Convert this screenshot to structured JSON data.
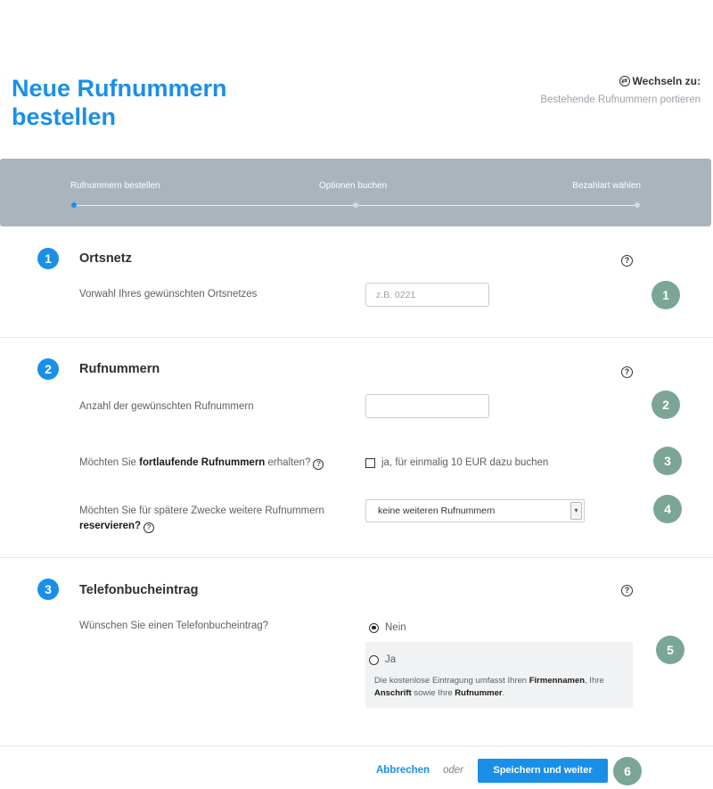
{
  "page": {
    "title": "Neue Rufnummern bestellen"
  },
  "switch": {
    "heading": "Wechseln zu:",
    "link": "Bestehende Rufnummern portieren"
  },
  "stepper": {
    "steps": [
      {
        "label": "Rufnummern bestellen",
        "active": true
      },
      {
        "label": "Optionen buchen",
        "active": false
      },
      {
        "label": "Bezahlart wählen",
        "active": false
      }
    ]
  },
  "sections": [
    {
      "number": "1",
      "title": "Ortsnetz",
      "fields": {
        "area_code_label": "Vorwahl Ihres gewünschten Ortsnetzes",
        "area_code_placeholder": "z.B. 0221",
        "area_code_value": ""
      }
    },
    {
      "number": "2",
      "title": "Rufnummern",
      "fields": {
        "count_label": "Anzahl der gewünschten Rufnummern",
        "count_value": "",
        "consecutive_prefix": "Möchten Sie ",
        "consecutive_bold": "fortlaufende Rufnummern",
        "consecutive_suffix": " erhalten?",
        "consecutive_checkbox_label": "ja, für einmalig 10 EUR dazu buchen",
        "consecutive_checked": false,
        "reserve_prefix": "Möchten Sie für spätere Zwecke weitere Rufnummern",
        "reserve_bold": "reservieren?",
        "reserve_selected": "keine weiteren Rufnummern"
      }
    },
    {
      "number": "3",
      "title": "Telefonbucheintrag",
      "fields": {
        "question": "Wünschen Sie einen Telefonbucheintrag?",
        "option_no": "Nein",
        "option_yes": "Ja",
        "selected": "Nein",
        "desc_1": "Die kostenlose Eintragung umfasst Ihren ",
        "desc_2": "Firmennamen",
        "desc_3": ", Ihre ",
        "desc_4": "Anschrift",
        "desc_5": " sowie Ihre ",
        "desc_6": "Rufnummer",
        "desc_7": "."
      }
    }
  ],
  "help_icon_glyph": "?",
  "badges": [
    "1",
    "2",
    "3",
    "4",
    "5",
    "6"
  ],
  "footer": {
    "cancel_label": "Abbrechen",
    "or_label": "oder",
    "save_label": "Speichern und weiter"
  },
  "colors": {
    "accent": "#1a8fe8",
    "stepper_bg": "#aab4bd",
    "badge": "#7ba695"
  }
}
